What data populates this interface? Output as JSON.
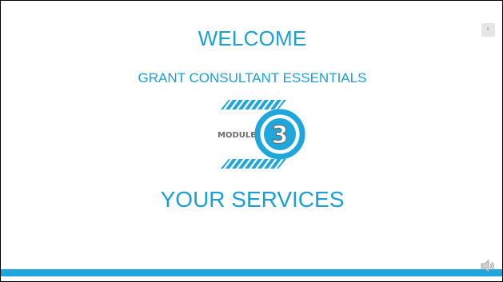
{
  "slide": {
    "number": "6",
    "welcome": "WELCOME",
    "subtitle": "GRANT CONSULTANT ESSENTIALS",
    "logo": {
      "word": "MODULE",
      "numeral": "3"
    },
    "section_title": "YOUR SERVICES"
  },
  "icons": {
    "logo": "module-3-badge-icon",
    "audio": "speaker-icon"
  },
  "colors": {
    "accent": "#1a9fd9",
    "bar": "#1ea6dd",
    "slide_number_bg": "#e6e6e6"
  }
}
